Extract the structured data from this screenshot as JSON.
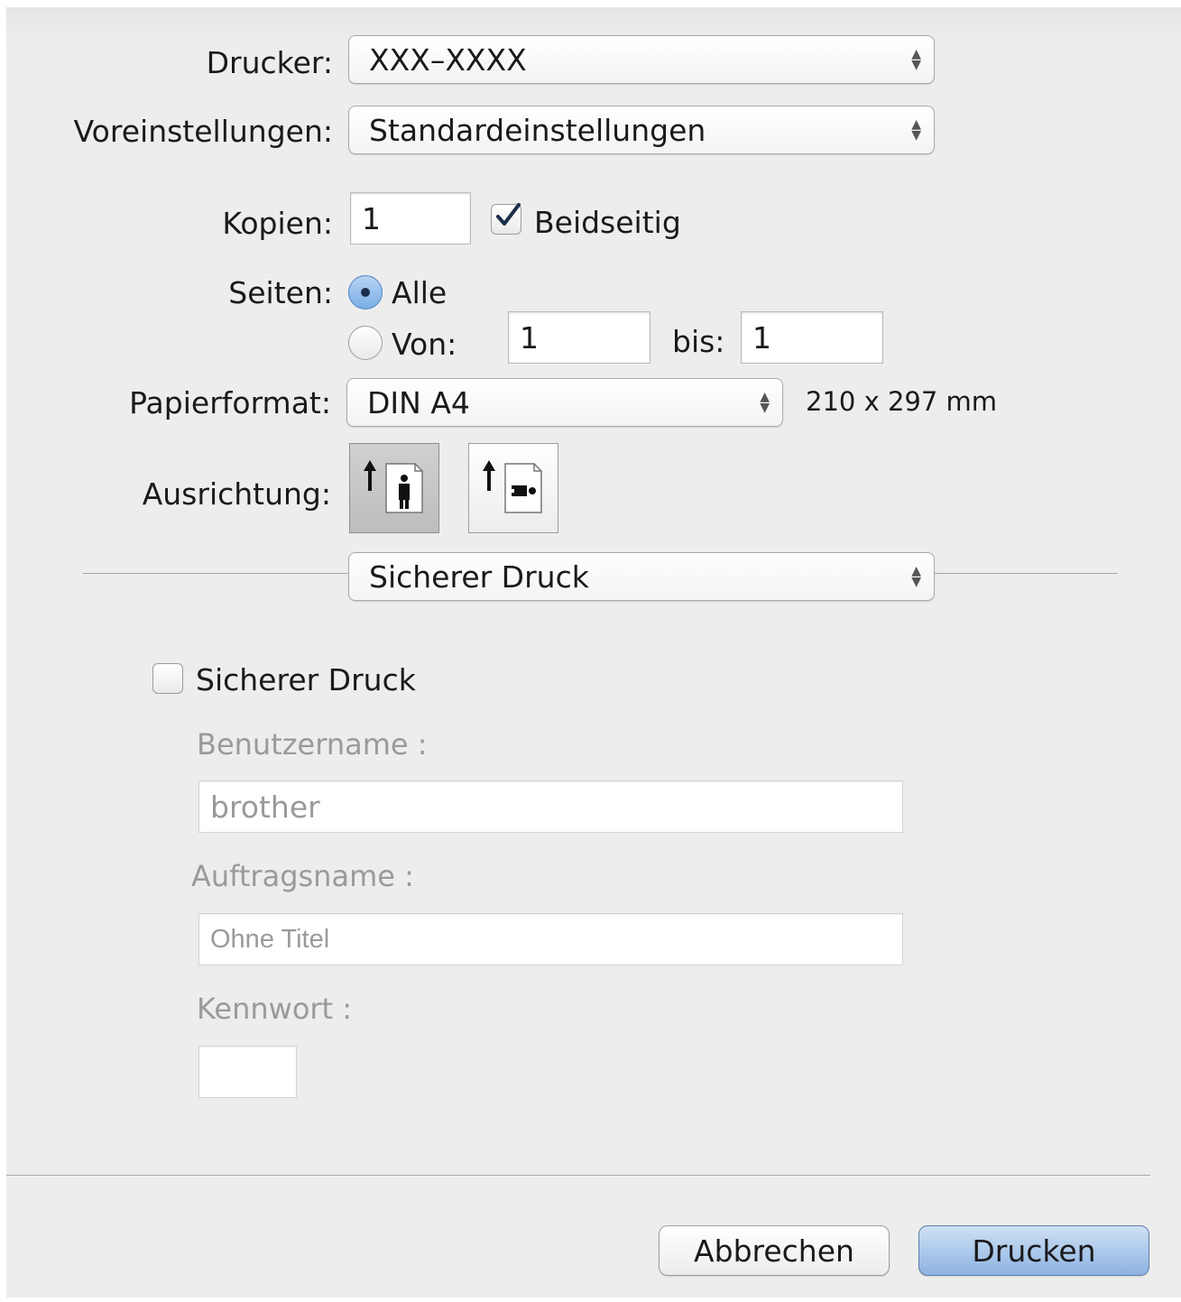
{
  "printer": {
    "label": "Drucker:",
    "value": "XXX–XXXX"
  },
  "presets": {
    "label": "Voreinstellungen:",
    "value": "Standardeinstellungen"
  },
  "copies": {
    "label": "Kopien:",
    "value": "1",
    "duplex_label": "Beidseitig",
    "duplex_checked": true
  },
  "pages": {
    "label": "Seiten:",
    "all_label": "Alle",
    "from_label": "Von:",
    "from_value": "1",
    "to_label": "bis:",
    "to_value": "1",
    "selected": "all"
  },
  "paper": {
    "label": "Papierformat:",
    "value": "DIN A4",
    "size_text": "210 x 297 mm"
  },
  "orientation": {
    "label": "Ausrichtung:",
    "selected": "portrait",
    "options": [
      "portrait-icon",
      "landscape-icon"
    ]
  },
  "section_popup": {
    "value": "Sicherer Druck"
  },
  "secure": {
    "checkbox_label": "Sicherer Druck",
    "checked": false,
    "username_label": "Benutzername :",
    "username_value": "brother",
    "jobname_label": "Auftragsname :",
    "jobname_value": "Ohne Titel",
    "password_label": "Kennwort :",
    "password_value": ""
  },
  "buttons": {
    "cancel": "Abbrechen",
    "print": "Drucken"
  },
  "colors": {
    "background": "#ededed",
    "accent": "#8db3e2",
    "disabled_text": "#9a9a9a"
  }
}
